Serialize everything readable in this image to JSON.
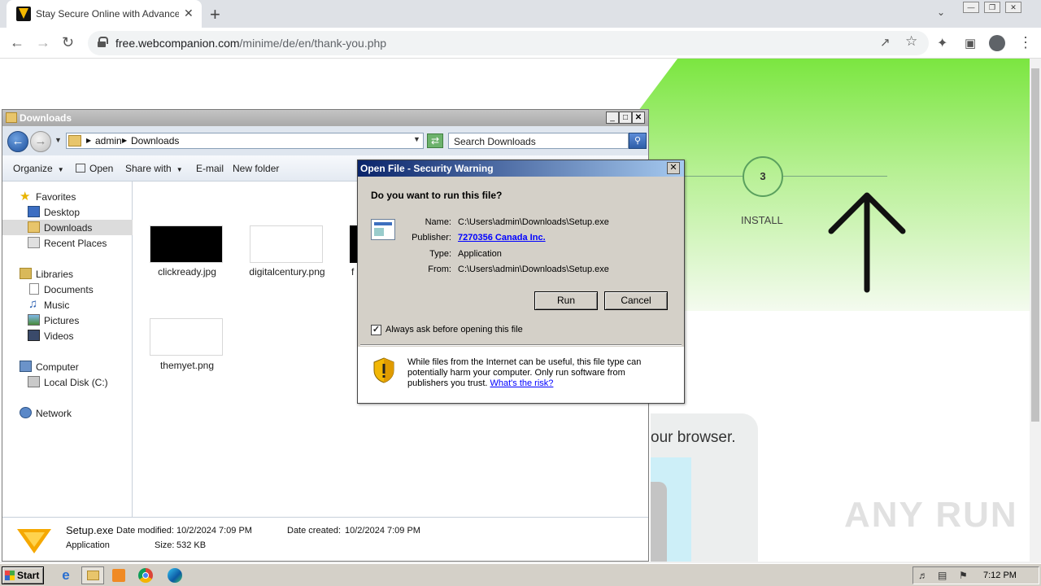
{
  "browser": {
    "tab_title": "Stay Secure Online with Advanced A",
    "tab_close": "✕",
    "new_tab": "+",
    "url_host": "free.webcompanion.com",
    "url_path": "/minime/de/en/thank-you.php"
  },
  "webpage": {
    "step_number": "3",
    "step_label": "INSTALL",
    "browser_text": "our browser.",
    "watermark": "ANY RUN"
  },
  "explorer": {
    "title": "Downloads",
    "breadcrumb": [
      "admin",
      "Downloads"
    ],
    "search_placeholder": "Search Downloads",
    "commands": {
      "organize": "Organize",
      "open": "Open",
      "share_with": "Share with",
      "email": "E-mail",
      "new_folder": "New folder"
    },
    "nav": {
      "favorites": "Favorites",
      "desktop": "Desktop",
      "downloads": "Downloads",
      "recent_places": "Recent Places",
      "libraries": "Libraries",
      "documents": "Documents",
      "music": "Music",
      "pictures": "Pictures",
      "videos": "Videos",
      "computer": "Computer",
      "local_disk": "Local Disk (C:)",
      "network": "Network"
    },
    "files": [
      {
        "name": "clickready.jpg"
      },
      {
        "name": "digitalcentury.png"
      },
      {
        "name": "f"
      },
      {
        "name": "themyet.png"
      }
    ],
    "details": {
      "file_name": "Setup.exe",
      "date_modified_label": "Date modified:",
      "date_modified": "10/2/2024 7:09 PM",
      "date_created_label": "Date created:",
      "date_created": "10/2/2024 7:09 PM",
      "type": "Application",
      "size_label": "Size:",
      "size": "532 KB"
    }
  },
  "security_dialog": {
    "title": "Open File - Security Warning",
    "question": "Do you want to run this file?",
    "name_label": "Name:",
    "name": "C:\\Users\\admin\\Downloads\\Setup.exe",
    "publisher_label": "Publisher:",
    "publisher": "7270356 Canada Inc.",
    "type_label": "Type:",
    "type": "Application",
    "from_label": "From:",
    "from": "C:\\Users\\admin\\Downloads\\Setup.exe",
    "run_button": "Run",
    "cancel_button": "Cancel",
    "checkbox_label": "Always ask before opening this file",
    "checkbox_checked": true,
    "warning_text": "While files from the Internet can be useful, this file type can potentially harm your computer. Only run software from publishers you trust.",
    "warning_link": "What's the risk?"
  },
  "taskbar": {
    "start_label": "Start",
    "clock": "7:12 PM"
  }
}
